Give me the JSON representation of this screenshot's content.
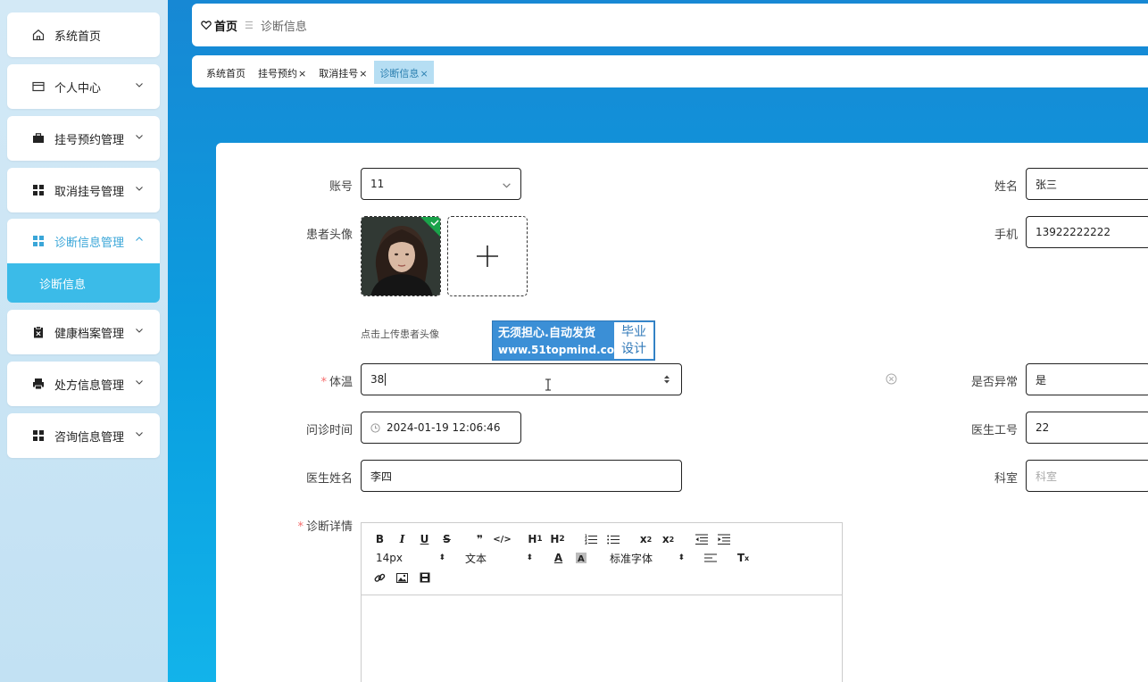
{
  "sidebar": {
    "items": [
      {
        "label": "系统首页",
        "icon": "home-icon"
      },
      {
        "label": "个人中心",
        "icon": "id-card-icon"
      },
      {
        "label": "挂号预约管理",
        "icon": "briefcase-icon"
      },
      {
        "label": "取消挂号管理",
        "icon": "grid-icon"
      },
      {
        "label": "诊断信息管理",
        "icon": "grid-icon"
      },
      {
        "label": "健康档案管理",
        "icon": "clipboard-icon"
      },
      {
        "label": "处方信息管理",
        "icon": "printer-icon"
      },
      {
        "label": "咨询信息管理",
        "icon": "grid-icon"
      }
    ],
    "submenu_label": "诊断信息"
  },
  "header": {
    "home_label": "首页",
    "current_label": "诊断信息"
  },
  "tabs": [
    {
      "label": "系统首页",
      "closable": false
    },
    {
      "label": "挂号预约",
      "closable": true
    },
    {
      "label": "取消挂号",
      "closable": true
    },
    {
      "label": "诊断信息",
      "closable": true
    }
  ],
  "close_glyph": "×",
  "form": {
    "account": {
      "label": "账号",
      "value": "11"
    },
    "name": {
      "label": "姓名",
      "value": "张三"
    },
    "avatar": {
      "label": "患者头像",
      "hint": "点击上传患者头像"
    },
    "phone": {
      "label": "手机",
      "value": "13922222222"
    },
    "temperature": {
      "label": "体温",
      "value": "38"
    },
    "abnormal": {
      "label": "是否异常",
      "value": "是"
    },
    "visit_time": {
      "label": "问诊时间",
      "value": "2024-01-19 12:06:46"
    },
    "doctor_id": {
      "label": "医生工号",
      "value": "22"
    },
    "doctor_name": {
      "label": "医生姓名",
      "value": "李四"
    },
    "department": {
      "label": "科室",
      "placeholder": "科室"
    },
    "details": {
      "label": "诊断详情"
    },
    "required_mark": "*"
  },
  "editor": {
    "font_size": "14px",
    "text_style": "文本",
    "font_family": "标准字体"
  },
  "watermark": {
    "line1": "无须担心.自动发货",
    "line2": "www.51topmind.com",
    "right1": "毕业",
    "right2": "设计"
  },
  "colors": {
    "accent": "#3bbbe8",
    "required": "#f56c6c",
    "active_tab_bg": "#b6def3"
  }
}
